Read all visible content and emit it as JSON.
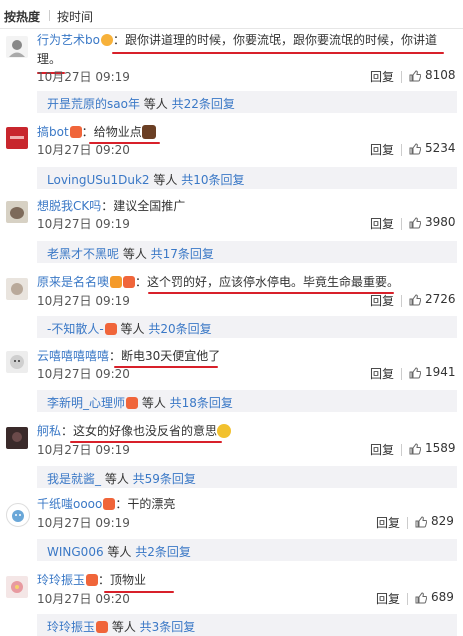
{
  "sort_tabs": {
    "hot": "按热度",
    "time": "按时间"
  },
  "labels": {
    "reply": "回复",
    "others_suffix": " 等人 "
  },
  "comments": [
    {
      "user": "行为艺术bo",
      "colon": "：",
      "text": "跟你讲道理的时候，你要流氓，跟你要流氓的时候，你讲道理。",
      "date": "10月27日 09:19",
      "likes": "8108",
      "sub_user": "开昰荒原的sao年",
      "sub_total": "共22条回复"
    },
    {
      "user": "搞bot",
      "colon": "：",
      "text": "给物业点",
      "date": "10月27日 09:20",
      "likes": "5234",
      "sub_user": "LovingUSu1Duk2",
      "sub_total": "共10条回复"
    },
    {
      "user": "想脱我CK吗",
      "colon": "：",
      "text": "建议全国推广",
      "date": "10月27日 09:19",
      "likes": "3980",
      "sub_user": "老黑才不黑呢",
      "sub_total": "共17条回复"
    },
    {
      "user": "原来是名名噢",
      "colon": "：",
      "text": "这个罚的好，应该停水停电。毕竟生命最重要。",
      "date": "10月27日 09:19",
      "likes": "2726",
      "sub_user": "-不知散人-",
      "sub_total": "共20条回复"
    },
    {
      "user": "云嘻嘻嘻嘻嘻",
      "colon": "：",
      "text": "断电30天便宜他了",
      "date": "10月27日 09:20",
      "likes": "1941",
      "sub_user": "李新明_心理师",
      "sub_total": "共18条回复"
    },
    {
      "user": "舸私",
      "colon": "：",
      "text": "这女的好像也没反省的意思",
      "date": "10月27日 09:19",
      "likes": "1589",
      "sub_user": "我是就酱_",
      "sub_total": "共59条回复"
    },
    {
      "user": "千纸嗤oooo",
      "colon": "：",
      "text": "干的漂亮",
      "date": "10月27日 09:19",
      "likes": "829",
      "sub_user": "WING006",
      "sub_total": "共2条回复"
    },
    {
      "user": "玲玲振玉",
      "colon": "：",
      "text": "顶物业",
      "date": "10月27日 09:20",
      "likes": "689",
      "sub_user": "玲玲振玉",
      "sub_total": "共3条回复"
    }
  ],
  "colors": {
    "link": "#3a78c6",
    "underline": "#d8202a",
    "subbox_bg": "#f2f2f5"
  }
}
